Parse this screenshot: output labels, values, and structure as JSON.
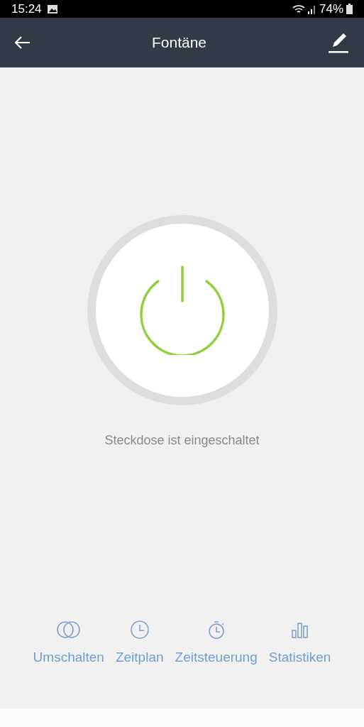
{
  "status_bar": {
    "time": "15:24",
    "battery": "74%"
  },
  "header": {
    "title": "Fontäne"
  },
  "power": {
    "on": true,
    "status": "Steckdose ist eingeschaltet"
  },
  "actions": [
    {
      "kind": "toggle",
      "label": "Umschalten"
    },
    {
      "kind": "schedule",
      "label": "Zeitplan"
    },
    {
      "kind": "timer",
      "label": "Zeitsteuerung"
    },
    {
      "kind": "stats",
      "label": "Statistiken"
    }
  ]
}
